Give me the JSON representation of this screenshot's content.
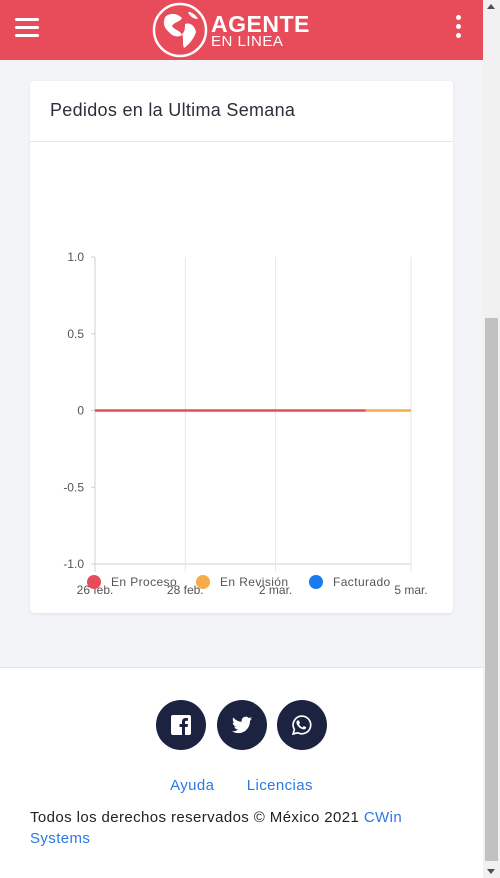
{
  "header": {
    "logo_line1": "AGENTE",
    "logo_line2": "EN LINEA",
    "menu_icon": "hamburger-icon",
    "more_icon": "kebab-icon",
    "color": "#e84c5a"
  },
  "card": {
    "title": "Pedidos en la Ultima Semana"
  },
  "chart_data": {
    "type": "line",
    "title": "Pedidos en la Ultima Semana",
    "x_ticks": [
      "26 feb.",
      "28 feb.",
      "2 mar.",
      "5 mar."
    ],
    "y_ticks": [
      "1.0",
      "0.5",
      "0",
      "-0.5",
      "-1.0"
    ],
    "ylim": [
      -1.0,
      1.0
    ],
    "xlim": [
      "26 feb.",
      "5 mar."
    ],
    "grid": "vertical",
    "legend_placement": "bottom",
    "series": [
      {
        "name": "En Proceso",
        "color": "#e84c5a",
        "x": [
          "26 feb.",
          "4 mar."
        ],
        "values": [
          0,
          0
        ]
      },
      {
        "name": "En Revisión",
        "color": "#f5ad4c",
        "x": [
          "4 mar.",
          "5 mar."
        ],
        "values": [
          0,
          0
        ]
      },
      {
        "name": "Facturado",
        "color": "#1a7af0",
        "x": [],
        "values": []
      }
    ]
  },
  "footer": {
    "social": [
      {
        "name": "facebook-icon"
      },
      {
        "name": "twitter-icon"
      },
      {
        "name": "whatsapp-icon"
      }
    ],
    "links": [
      "Ayuda",
      "Licencias"
    ],
    "copyright_text": "Todos los derechos reservados © México 2021 ",
    "company_link": "CWin Systems"
  }
}
